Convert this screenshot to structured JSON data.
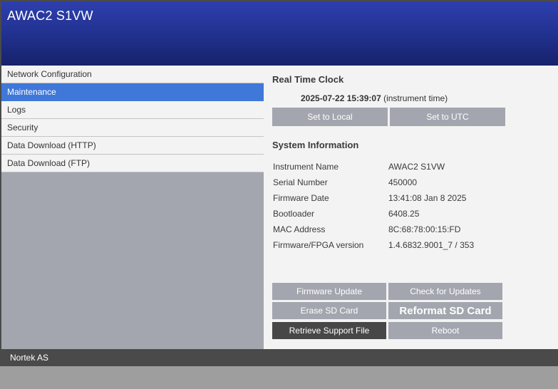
{
  "header": {
    "title": "AWAC2 S1VW"
  },
  "sidebar": {
    "items": [
      {
        "label": "Network Configuration"
      },
      {
        "label": "Maintenance"
      },
      {
        "label": "Logs"
      },
      {
        "label": "Security"
      },
      {
        "label": "Data Download (HTTP)"
      },
      {
        "label": "Data Download (FTP)"
      }
    ],
    "active_index": 1
  },
  "rtc": {
    "title": "Real Time Clock",
    "datetime": "2025-07-22 15:39:07",
    "suffix": " (instrument time)",
    "set_local_label": "Set to Local",
    "set_utc_label": "Set to UTC"
  },
  "sysinfo": {
    "title": "System Information",
    "rows": [
      {
        "key": "Instrument Name",
        "value": "AWAC2 S1VW"
      },
      {
        "key": "Serial Number",
        "value": "450000"
      },
      {
        "key": "Firmware Date",
        "value": "13:41:08 Jan 8 2025"
      },
      {
        "key": "Bootloader",
        "value": "6408.25"
      },
      {
        "key": "MAC Address",
        "value": "8C:68:78:00:15:FD"
      },
      {
        "key": "Firmware/FPGA version",
        "value": "1.4.6832.9001_7 / 353"
      }
    ]
  },
  "actions": {
    "firmware_update": "Firmware Update",
    "check_updates": "Check for Updates",
    "erase_sd": "Erase SD Card",
    "reformat_sd": "Reformat SD Card",
    "retrieve_support": "Retrieve Support File",
    "reboot": "Reboot"
  },
  "footer": {
    "text": "Nortek AS"
  },
  "colors": {
    "header_top": "#2e3fae",
    "header_bottom": "#16226b",
    "active_nav": "#3f78d8",
    "button_gray": "#a3a6ae",
    "button_dark": "#474747",
    "footer": "#4a4a4a"
  }
}
